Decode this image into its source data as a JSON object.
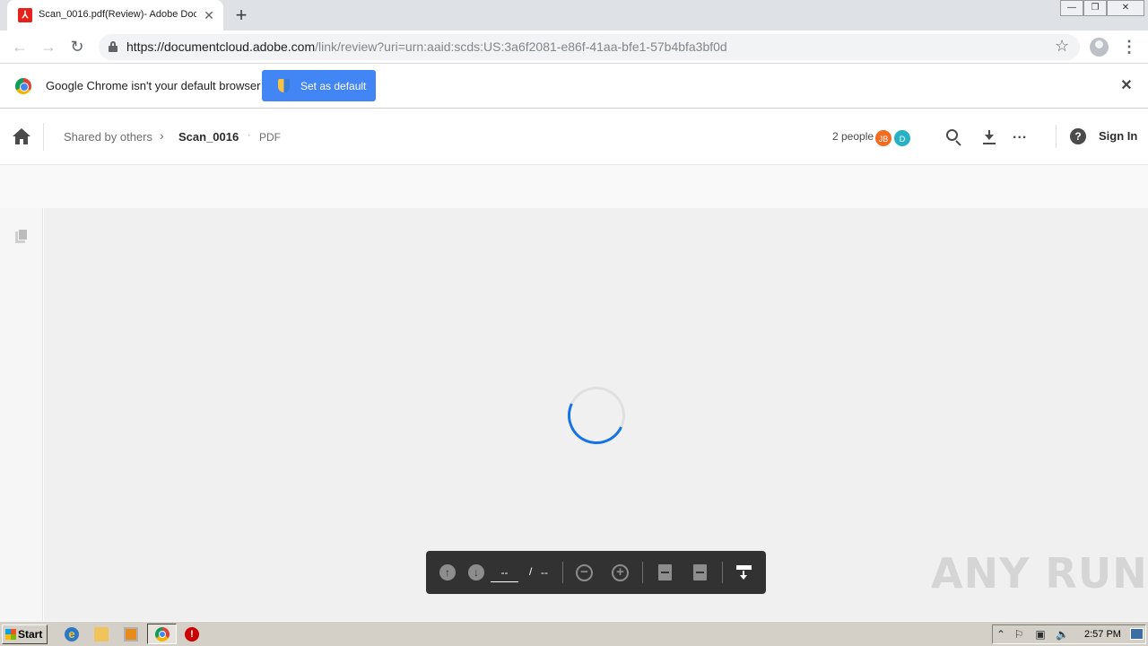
{
  "browser": {
    "tab": {
      "title": "Scan_0016.pdf(Review)- Adobe Doc",
      "close": "✕",
      "favicon": "acrobat-icon"
    },
    "new_tab": "+",
    "window_controls": {
      "minimize": "—",
      "restore": "❐",
      "close": "✕"
    },
    "nav": {
      "back": "←",
      "forward": "→",
      "reload": "↻"
    },
    "url_host": "https://documentcloud.adobe.com",
    "url_rest": "/link/review?uri=urn:aaid:scds:US:3a6f2081-e86f-41aa-bfe1-57b4bfa3bf0d",
    "bookmark": "☆",
    "menu": "⋮"
  },
  "infobar": {
    "message": "Google Chrome isn't your default browser",
    "button": "Set as default",
    "close": "✕"
  },
  "header": {
    "breadcrumb_root": "Shared by others",
    "chevron": "›",
    "file_name": "Scan_0016",
    "dot": "·",
    "file_type": "PDF",
    "people_count": "2 people",
    "avatars": [
      "JB",
      "D"
    ],
    "more": "...",
    "help": "?",
    "sign_in": "Sign In"
  },
  "pagebar": {
    "prev": "↑",
    "next": "↓",
    "page_input": "--",
    "slash": "/",
    "total": "--",
    "zoom_out": "−",
    "zoom_in": "+"
  },
  "watermark": "ANY RUN",
  "taskbar": {
    "start": "Start",
    "ie": "e",
    "stop": "!",
    "tray_up": "⌃",
    "tray_flag": "⚐",
    "tray_net": "▣",
    "tray_vol": "🔈",
    "clock": "2:57 PM"
  },
  "colors": {
    "accent_blue": "#4285f4",
    "adobe_red": "#e5231b",
    "spinner_blue": "#1473e6",
    "avatar_jb": "#f26b21",
    "avatar_d": "#26b2c4"
  }
}
